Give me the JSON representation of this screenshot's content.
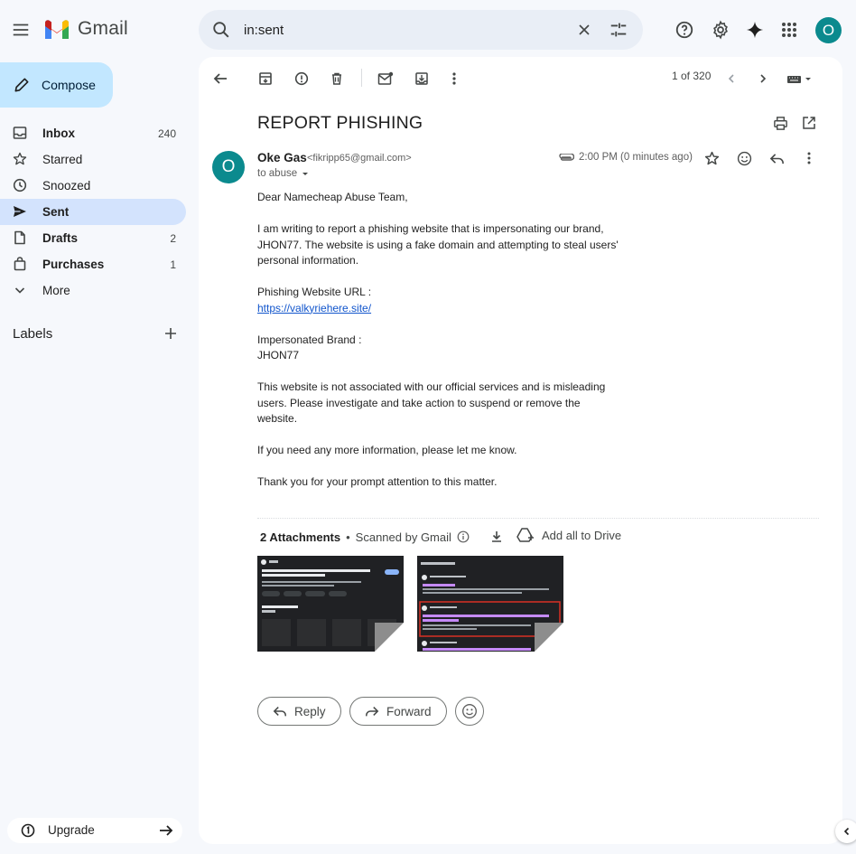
{
  "app": {
    "name": "Gmail"
  },
  "search": {
    "value": "in:sent"
  },
  "account": {
    "initial": "O"
  },
  "compose": {
    "label": "Compose"
  },
  "sidebar": {
    "items": [
      {
        "label": "Inbox",
        "count": "240",
        "bold": true,
        "icon": "inbox-icon"
      },
      {
        "label": "Starred",
        "count": "",
        "bold": false,
        "icon": "star-icon"
      },
      {
        "label": "Snoozed",
        "count": "",
        "bold": false,
        "icon": "clock-icon"
      },
      {
        "label": "Sent",
        "count": "",
        "bold": true,
        "icon": "send-icon",
        "active": true
      },
      {
        "label": "Drafts",
        "count": "2",
        "bold": true,
        "icon": "draft-icon"
      },
      {
        "label": "Purchases",
        "count": "1",
        "bold": true,
        "icon": "bag-icon"
      },
      {
        "label": "More",
        "count": "",
        "bold": false,
        "icon": "chevron-down-icon"
      }
    ],
    "labels_title": "Labels",
    "upgrade": "Upgrade"
  },
  "toolbar": {
    "pager": "1 of 320"
  },
  "email": {
    "subject": "REPORT PHISHING",
    "sender_initial": "O",
    "sender_name": "Oke Gas",
    "sender_email": "<fikripp65@gmail.com>",
    "to": "to abuse",
    "time": "2:00 PM (0 minutes ago)",
    "body": {
      "greeting": "Dear Namecheap Abuse Team,",
      "p1": "I am writing to report a phishing website that is impersonating our brand, JHON77. The website is using a fake domain and attempting to steal users' personal information.",
      "url_label": "Phishing Website URL :",
      "url": "https://valkyriehere.site/",
      "brand_label": "Impersonated Brand :",
      "brand": "JHON77",
      "p2": "This website is not associated with our official services and is misleading users. Please investigate and take action to suspend or remove the website.",
      "p3": "If you need any more information, please let me know.",
      "p4": "Thank you for your prompt attention to this matter."
    }
  },
  "attachments": {
    "count_label": "2 Attachments",
    "scanned": "Scanned by Gmail",
    "drive_label": "Add all to Drive"
  },
  "actions": {
    "reply": "Reply",
    "forward": "Forward"
  },
  "colors": {
    "accent": "#0b8a8e",
    "compose_bg": "#c2e7ff",
    "active_bg": "#d3e3fd",
    "link": "#1155cc"
  }
}
